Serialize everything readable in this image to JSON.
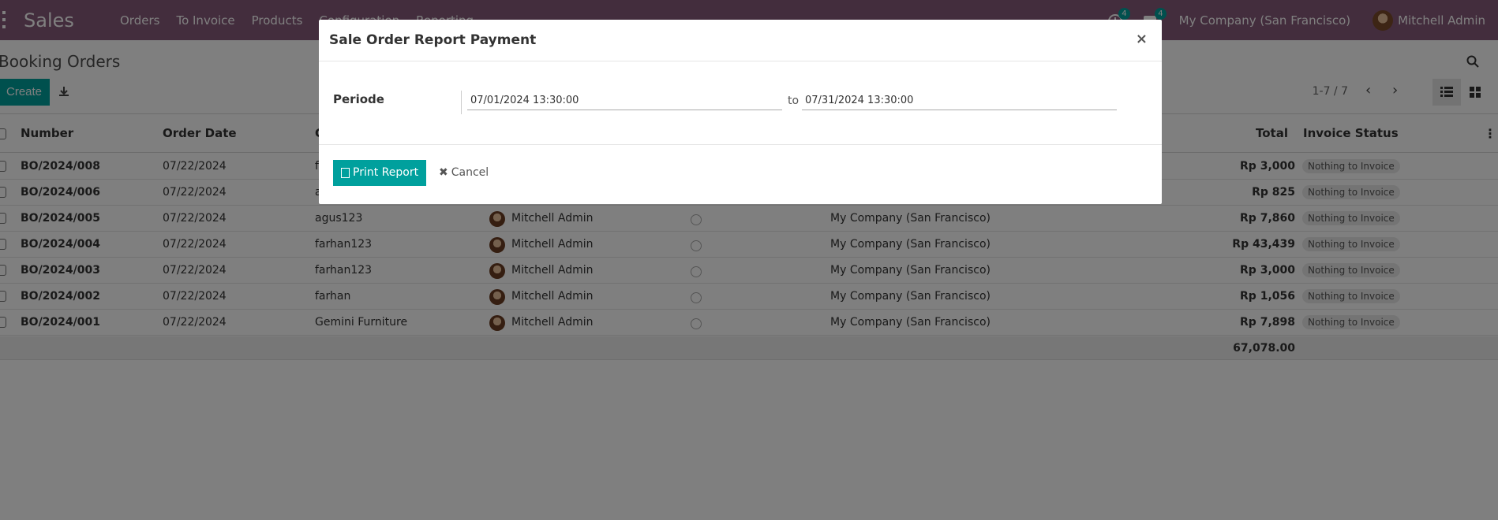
{
  "navbar": {
    "brand": "Sales",
    "menu": [
      "Orders",
      "To Invoice",
      "Products",
      "Configuration",
      "Reporting"
    ],
    "activity_count": "4",
    "messages_count": "4",
    "company": "My Company (San Francisco)",
    "user": "Mitchell Admin"
  },
  "control_panel": {
    "breadcrumb": "Booking Orders",
    "create_label": "Create",
    "pager": "1-7 / 7"
  },
  "table": {
    "columns": {
      "number": "Number",
      "order_date": "Order Date",
      "customer": "C",
      "total": "Total",
      "invoice_status": "Invoice Status"
    },
    "rows": [
      {
        "number": "BO/2024/008",
        "date": "07/22/2024",
        "customer": "f",
        "salesperson": "",
        "company": "",
        "total": "Rp 3,000",
        "status": "Nothing to Invoice"
      },
      {
        "number": "BO/2024/006",
        "date": "07/22/2024",
        "customer": "a",
        "salesperson": "",
        "company": "",
        "total": "Rp 825",
        "status": "Nothing to Invoice"
      },
      {
        "number": "BO/2024/005",
        "date": "07/22/2024",
        "customer": "agus123",
        "salesperson": "Mitchell Admin",
        "company": "My Company (San Francisco)",
        "total": "Rp 7,860",
        "status": "Nothing to Invoice"
      },
      {
        "number": "BO/2024/004",
        "date": "07/22/2024",
        "customer": "farhan123",
        "salesperson": "Mitchell Admin",
        "company": "My Company (San Francisco)",
        "total": "Rp 43,439",
        "status": "Nothing to Invoice"
      },
      {
        "number": "BO/2024/003",
        "date": "07/22/2024",
        "customer": "farhan123",
        "salesperson": "Mitchell Admin",
        "company": "My Company (San Francisco)",
        "total": "Rp 3,000",
        "status": "Nothing to Invoice"
      },
      {
        "number": "BO/2024/002",
        "date": "07/22/2024",
        "customer": "farhan",
        "salesperson": "Mitchell Admin",
        "company": "My Company (San Francisco)",
        "total": "Rp 1,056",
        "status": "Nothing to Invoice"
      },
      {
        "number": "BO/2024/001",
        "date": "07/22/2024",
        "customer": "Gemini Furniture",
        "salesperson": "Mitchell Admin",
        "company": "My Company (San Francisco)",
        "total": "Rp 7,898",
        "status": "Nothing to Invoice"
      }
    ],
    "grand_total": "67,078.00"
  },
  "modal": {
    "title": "Sale Order Report Payment",
    "close": "×",
    "periode_label": "Periode",
    "date_from": "07/01/2024 13:30:00",
    "to_label": "to",
    "date_to": "07/31/2024 13:30:00",
    "print_label": "Print Report",
    "cancel_label": "Cancel"
  },
  "colors": {
    "navbar": "#875a7b",
    "primary": "#00a09d"
  }
}
